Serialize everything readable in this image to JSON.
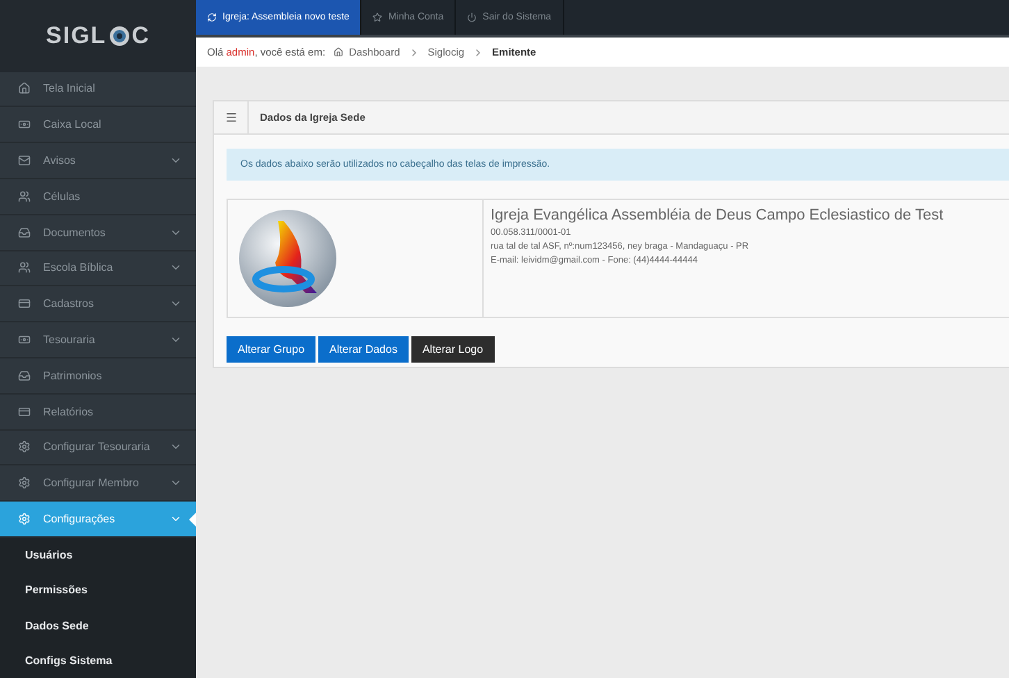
{
  "logo": {
    "left": "SIGL",
    "right": "C"
  },
  "top_tabs": [
    {
      "label": "Igreja: Assembleia novo teste",
      "selected": true
    },
    {
      "label": "Minha Conta",
      "selected": false
    },
    {
      "label": "Sair do Sistema",
      "selected": false
    }
  ],
  "breadcrumb": {
    "greeting": "Olá",
    "user": "admin",
    "suffix": ", você está em:",
    "items": [
      {
        "label": "Dashboard",
        "current": false
      },
      {
        "label": "Siglocig",
        "current": false
      },
      {
        "label": "Emitente",
        "current": true
      }
    ]
  },
  "sidebar": {
    "items": [
      {
        "label": "Tela Inicial",
        "expandable": false,
        "selected": false
      },
      {
        "label": "Caixa Local",
        "expandable": false,
        "selected": false
      },
      {
        "label": "Avisos",
        "expandable": true,
        "selected": false
      },
      {
        "label": "Células",
        "expandable": false,
        "selected": false
      },
      {
        "label": "Documentos",
        "expandable": true,
        "selected": false
      },
      {
        "label": "Escola Bíblica",
        "expandable": true,
        "selected": false
      },
      {
        "label": "Cadastros",
        "expandable": true,
        "selected": false
      },
      {
        "label": "Tesouraria",
        "expandable": true,
        "selected": false
      },
      {
        "label": "Patrimonios",
        "expandable": false,
        "selected": false
      },
      {
        "label": "Relatórios",
        "expandable": false,
        "selected": false
      },
      {
        "label": "Configurar Tesouraria",
        "expandable": true,
        "selected": false
      },
      {
        "label": "Configurar Membro",
        "expandable": true,
        "selected": false
      },
      {
        "label": "Configurações",
        "expandable": true,
        "selected": true,
        "children": [
          {
            "label": "Usuários",
            "selected": false
          },
          {
            "label": "Permissões",
            "selected": false
          },
          {
            "label": "Dados Sede",
            "selected": false
          },
          {
            "label": "Configs Sistema",
            "selected": false
          }
        ]
      }
    ]
  },
  "panel": {
    "title": "Dados da Igreja Sede",
    "notice": "Os dados abaixo serão utilizados no cabeçalho das telas de impressão.",
    "church": {
      "name": "Igreja Evangélica Assembléia de Deus Campo Eclesiastico de Test",
      "cnpj": "00.058.311/0001-01",
      "address": "rua tal de tal ASF, nº:num123456, ney braga - Mandaguaçu - PR",
      "contact": "E-mail: leividm@gmail.com - Fone: (44)4444-44444"
    },
    "buttons": [
      {
        "label": "Alterar Grupo",
        "kind": "primary"
      },
      {
        "label": "Alterar Dados",
        "kind": "primary"
      },
      {
        "label": "Alterar Logo",
        "kind": "dark"
      }
    ]
  }
}
